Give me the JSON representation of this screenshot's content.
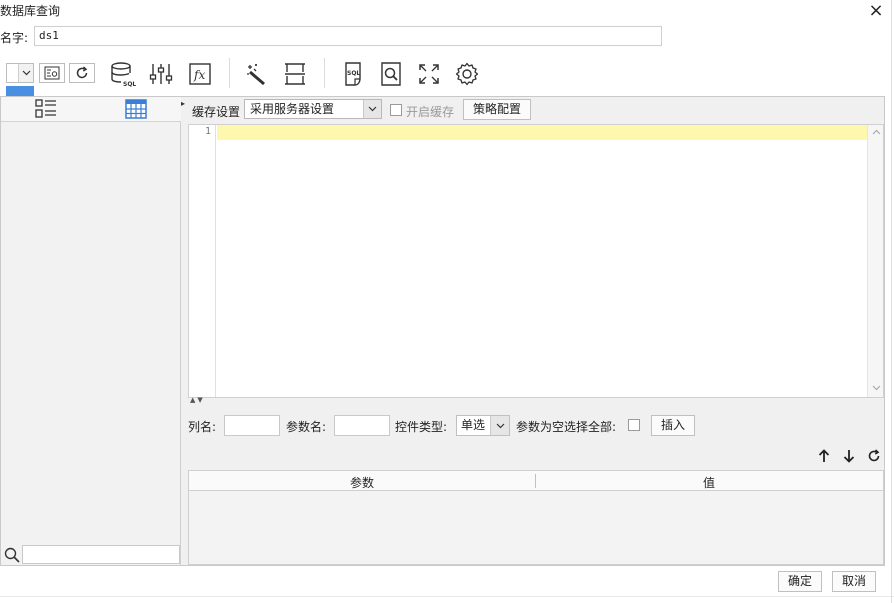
{
  "window": {
    "title": "数据库查询",
    "close_glyph": "×"
  },
  "name_field": {
    "label": "名字:",
    "value": "ds1"
  },
  "toolbar": {
    "icons": [
      "dropdown-chevron-icon",
      "image-preview-icon",
      "refresh-icon",
      "database-sql-icon",
      "sliders-icon",
      "formula-fx-icon",
      "magic-wand-icon",
      "column-divider-icon",
      "sql-file-icon",
      "search-document-icon",
      "fullscreen-icon",
      "settings-gear-icon"
    ]
  },
  "left_panel": {
    "icons": [
      "list-view-icon",
      "table-grid-icon",
      "search-icon"
    ]
  },
  "cache": {
    "label": "缓存设置",
    "select_value": "采用服务器设置",
    "enable_label": "开启缓存",
    "strategy_button": "策略配置"
  },
  "editor": {
    "line_numbers": [
      "1"
    ]
  },
  "params_form": {
    "column_label": "列名:",
    "param_name_label": "参数名:",
    "control_type_label": "控件类型:",
    "control_type_value": "单选",
    "empty_select_all_label": "参数为空选择全部:",
    "insert_button": "插入"
  },
  "params_table": {
    "columns": [
      "参数",
      "值"
    ]
  },
  "footer": {
    "ok": "确定",
    "cancel": "取消"
  },
  "colors": {
    "accent": "#4a90e2",
    "line_highlight": "#fdf8ad",
    "icon": "#3a3a3a"
  }
}
